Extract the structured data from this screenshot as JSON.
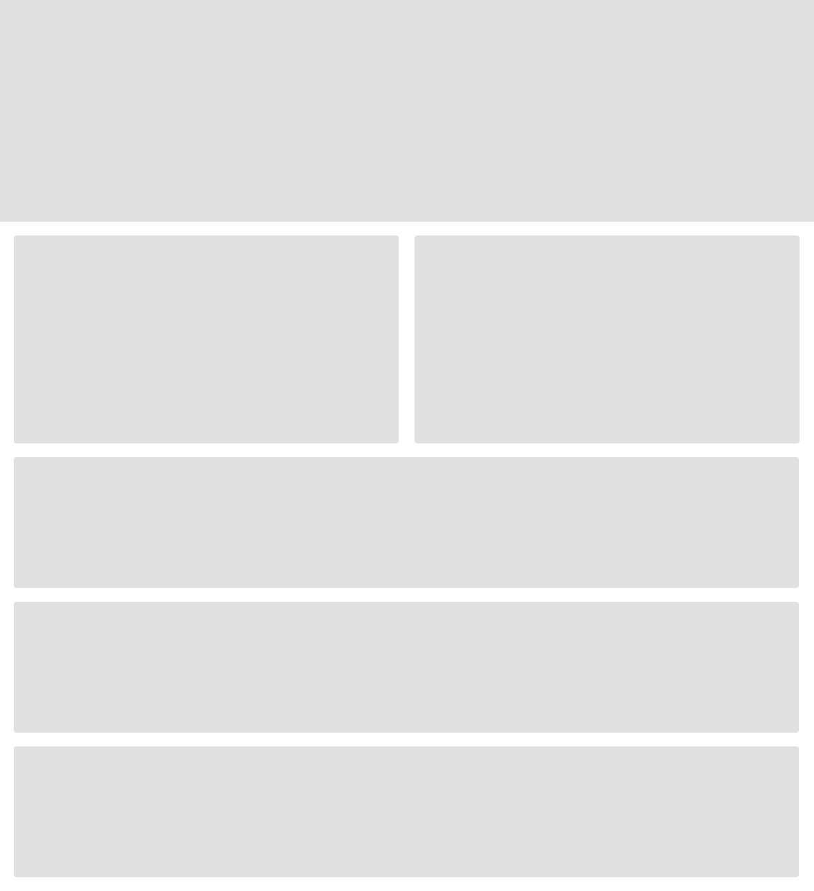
{
  "page": {
    "state": "loading-skeleton"
  },
  "colors": {
    "background": "#ffffff",
    "placeholder": "#e0e0e0"
  },
  "skeleton": {
    "hero": {
      "kind": "banner-placeholder"
    },
    "top_row": [
      {
        "kind": "card-placeholder"
      },
      {
        "kind": "card-placeholder"
      }
    ],
    "stacked": [
      {
        "kind": "section-placeholder"
      },
      {
        "kind": "section-placeholder"
      },
      {
        "kind": "section-placeholder"
      }
    ]
  }
}
